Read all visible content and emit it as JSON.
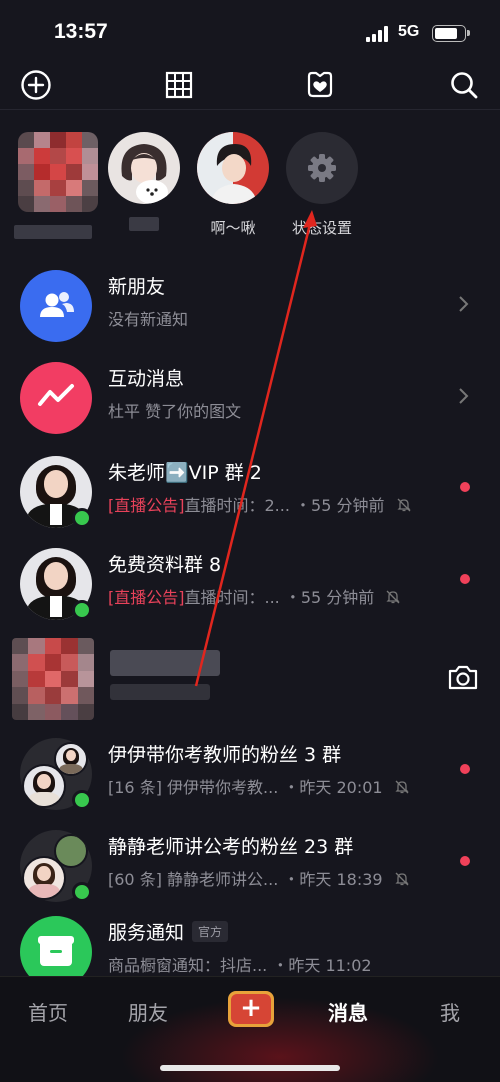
{
  "status_bar": {
    "time": "13:57",
    "network": "5G",
    "icons": [
      "signal-icon",
      "battery-icon"
    ]
  },
  "top_bar": {
    "icons": [
      "add-circle-icon",
      "grid-icon",
      "heart-bubble-icon",
      "search-icon"
    ]
  },
  "stories": [
    {
      "name": "",
      "icon": "avatar"
    },
    {
      "name": "",
      "icon": "avatar"
    },
    {
      "name": "啊～啾",
      "icon": "avatar"
    },
    {
      "name": "状态设置",
      "icon": "gear-icon"
    }
  ],
  "items": [
    {
      "title": "新朋友",
      "subtitle": "没有新通知",
      "icon": "people-icon",
      "color": "#3a6cf0"
    },
    {
      "title": "互动消息",
      "subtitle": "杜平 赞了你的图文",
      "icon": "zigzag-icon",
      "color": "#f23d63"
    },
    {
      "title": "朱老师➡️VIP 群 2",
      "tag": "[直播公告]",
      "subtitle": "直播时间：2...",
      "time": "・55 分钟前"
    },
    {
      "title": "免费资料群 8",
      "tag": "[直播公告]",
      "subtitle": "直播时间：...",
      "time": "・55 分钟前"
    },
    {
      "title": "",
      "subtitle": ""
    },
    {
      "title": "伊伊带你考教师的粉丝 3 群",
      "subtitle": "[16 条] 伊伊带你考教...",
      "time": "・昨天 20:01"
    },
    {
      "title": "静静老师讲公考的粉丝 23 群",
      "subtitle": "[60 条] 静静老师讲公...",
      "time": "・昨天 18:39"
    },
    {
      "title": "服务通知",
      "badge": "官方",
      "subtitle": "商品橱窗通知：抖店...",
      "time": "・昨天 11:02",
      "icon": "box-icon",
      "color": "#2bc85a"
    }
  ],
  "bottom_nav": {
    "home": "首页",
    "friends": "朋友",
    "plus": "+",
    "messages": "消息",
    "me": "我"
  }
}
